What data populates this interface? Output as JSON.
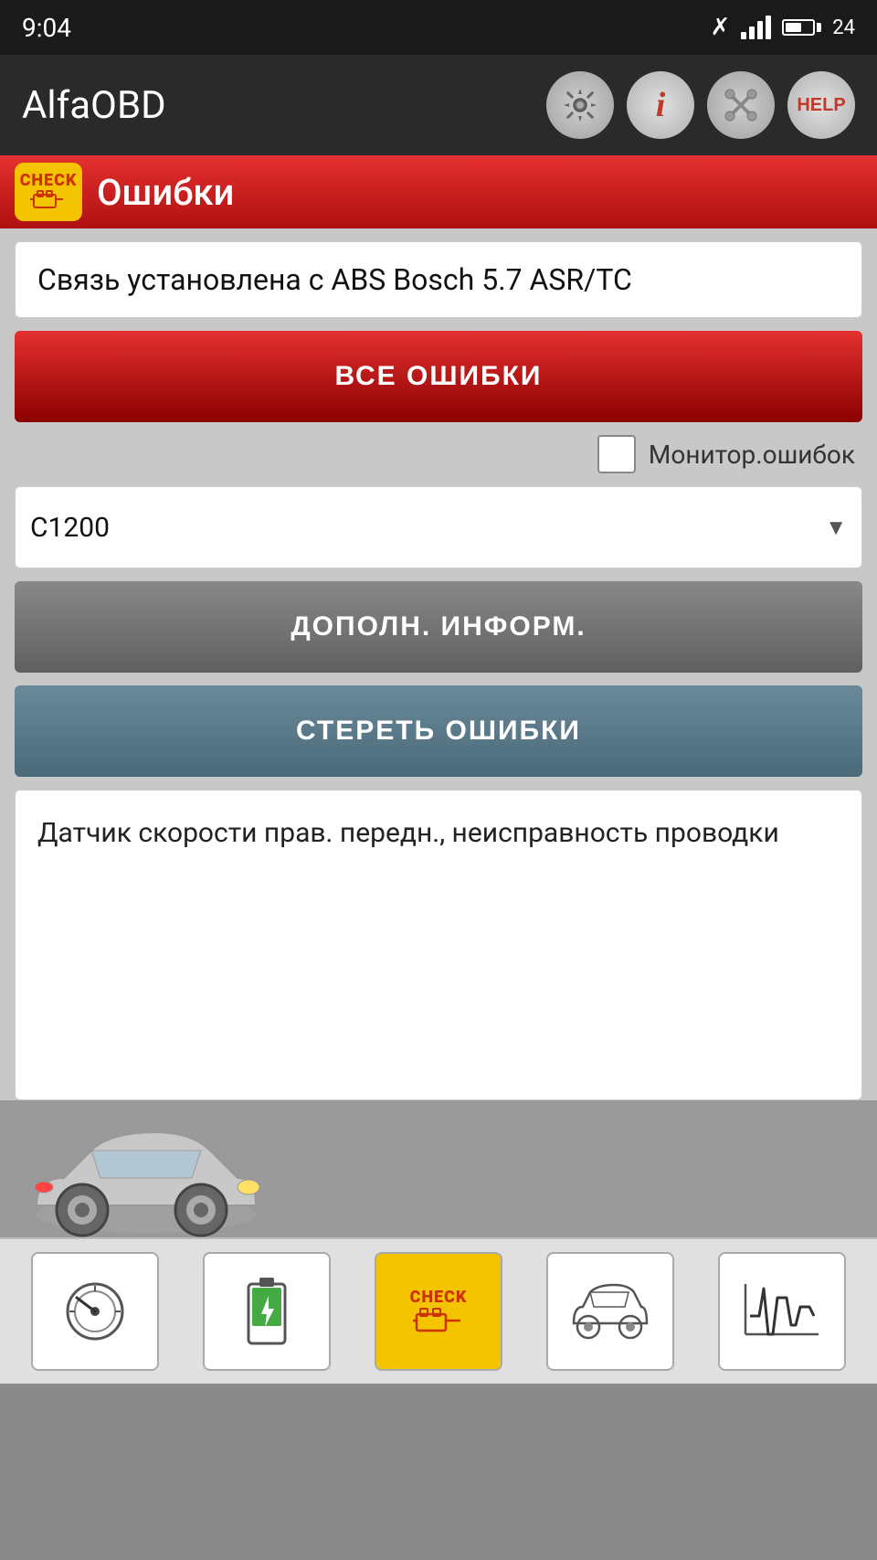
{
  "status_bar": {
    "time": "9:04",
    "battery_level": "24"
  },
  "toolbar": {
    "title": "AlfaOBD",
    "btn_gear_label": "⚙",
    "btn_info_label": "i",
    "btn_tools_label": "✕",
    "btn_help_label": "HELP"
  },
  "section": {
    "header_title": "Ошибки",
    "check_label": "CHECK"
  },
  "connection": {
    "text": "Связь установлена с ABS Bosch 5.7 ASR/TC"
  },
  "buttons": {
    "all_errors": "ВСЕ ОШИБКИ",
    "additional_info": "ДОПОЛН. ИНФОРМ.",
    "clear_errors": "СТЕРЕТЬ ОШИБКИ"
  },
  "monitor_checkbox": {
    "label": "Монитор.ошибок",
    "checked": false
  },
  "dropdown": {
    "value": "С1200"
  },
  "description": {
    "text": "Датчик скорости прав. передн., неисправность проводки"
  },
  "bottom_nav": {
    "items": [
      {
        "id": "gauge",
        "icon": "⊙",
        "label": "gauge"
      },
      {
        "id": "battery",
        "icon": "🔋",
        "label": "battery"
      },
      {
        "id": "check",
        "icon": "CHECK",
        "label": "check"
      },
      {
        "id": "car",
        "icon": "🚗",
        "label": "car"
      },
      {
        "id": "chart",
        "icon": "📈",
        "label": "chart"
      }
    ]
  }
}
